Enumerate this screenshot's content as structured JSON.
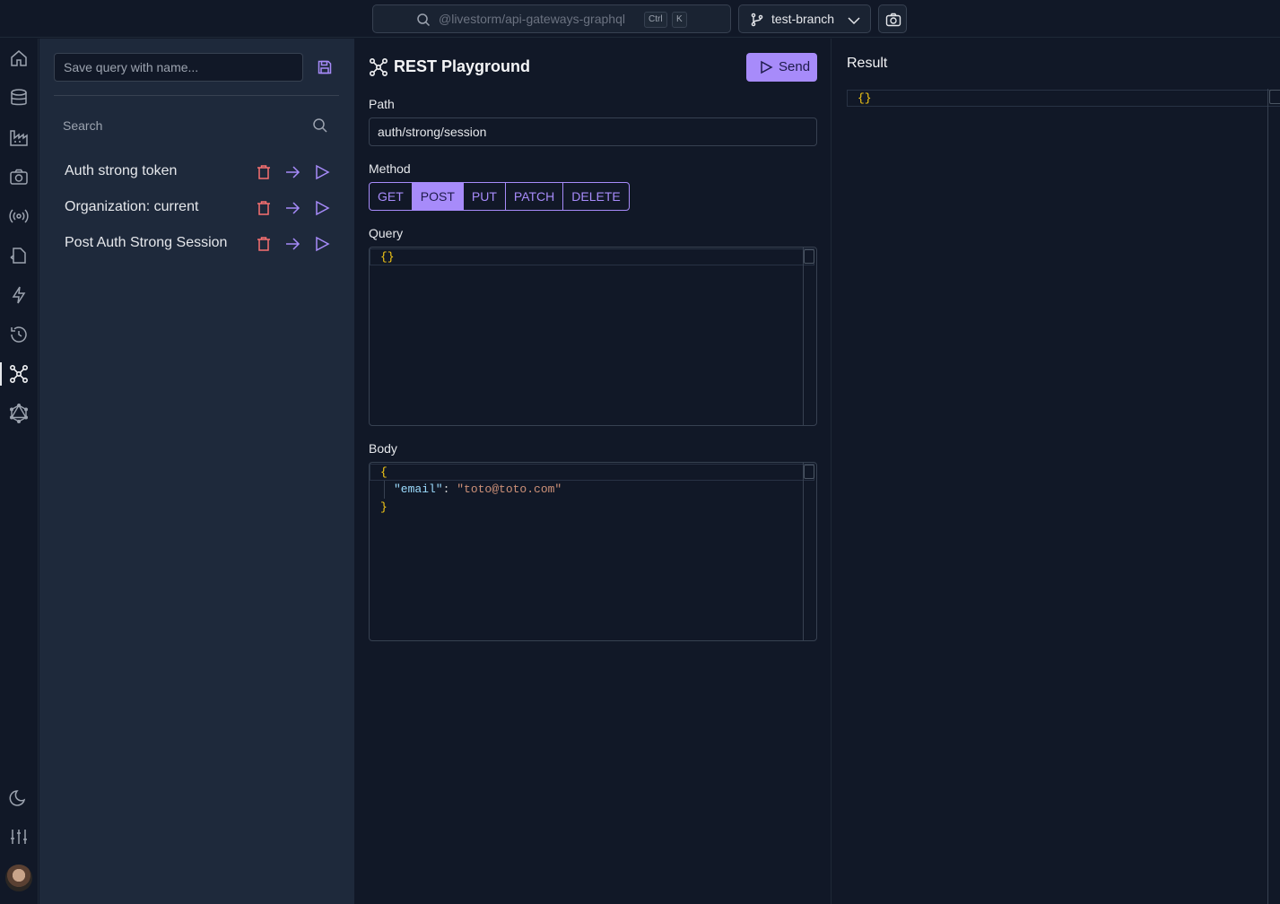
{
  "topbar": {
    "project_search": "@livestorm/api-gateways-graphql",
    "shortcut_key1": "Ctrl",
    "shortcut_key2": "K",
    "branch": "test-branch"
  },
  "rail": {
    "icons": [
      "home-icon",
      "database-icon",
      "factory-icon",
      "camera-icon",
      "broadcast-icon",
      "file-code-icon",
      "lightning-icon",
      "history-icon",
      "graph-icon",
      "graphql-icon",
      "moon-icon",
      "sliders-icon",
      "avatar"
    ],
    "active": "graph-icon"
  },
  "queries_panel": {
    "save_placeholder": "Save query with name...",
    "search_placeholder": "Search",
    "items": [
      {
        "label": "Auth strong token"
      },
      {
        "label": "Organization: current"
      },
      {
        "label": "Post Auth Strong Session"
      }
    ]
  },
  "playground": {
    "title": "REST Playground",
    "send_label": "Send",
    "path_label": "Path",
    "path_value": "auth/strong/session",
    "method_label": "Method",
    "methods": [
      "GET",
      "POST",
      "PUT",
      "PATCH",
      "DELETE"
    ],
    "selected_method": "POST",
    "query_label": "Query",
    "query_value": "{}",
    "body_label": "Body",
    "body_lines": {
      "open": "{",
      "key": "\"email\"",
      "colon": ": ",
      "value": "\"toto@toto.com\"",
      "close": "}"
    }
  },
  "result": {
    "title": "Result",
    "value": "{}"
  },
  "colors": {
    "accent": "#a78bfa",
    "delete": "#f87171",
    "background": "#111827",
    "panel": "#1e293b"
  }
}
